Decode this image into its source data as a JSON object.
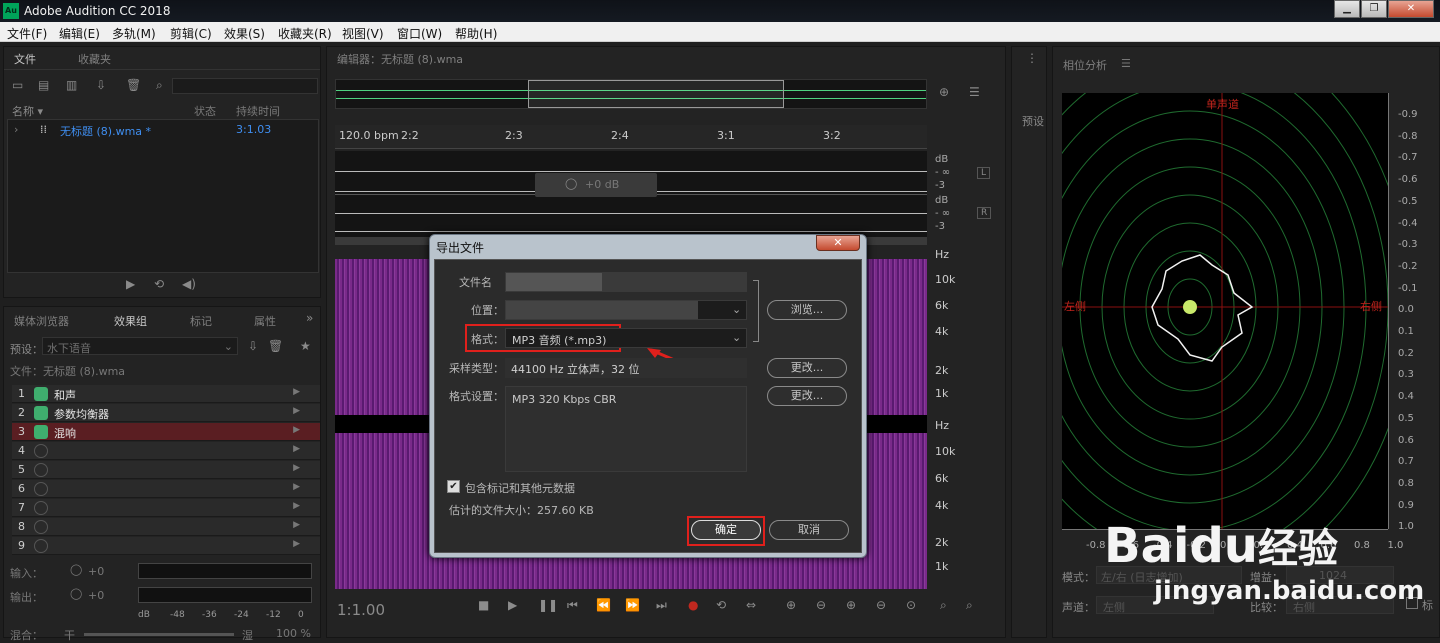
{
  "app": {
    "title": "Adobe Audition CC 2018",
    "logo": "Au",
    "win_buttons": [
      "▁",
      "❐",
      "✕"
    ]
  },
  "menu": [
    "文件(F)",
    "编辑(E)",
    "多轨(M)",
    "剪辑(C)",
    "效果(S)",
    "收藏夹(R)",
    "视图(V)",
    "窗口(W)",
    "帮助(H)"
  ],
  "files_panel": {
    "tabs": [
      "文件",
      "收藏夹"
    ],
    "columns": {
      "name": "名称 ▾",
      "status": "状态",
      "duration": "持续时间"
    },
    "file": {
      "name": "无标题 (8).wma *",
      "duration": "3:1.03"
    }
  },
  "effects_panel": {
    "tabs": [
      "媒体浏览器",
      "效果组",
      "标记",
      "属性"
    ],
    "preset_label": "预设：",
    "preset_value": "水下语音",
    "file_label": "文件：无标题 (8).wma",
    "rows": [
      {
        "n": "1",
        "label": "和声",
        "on": true
      },
      {
        "n": "2",
        "label": "参数均衡器",
        "on": true
      },
      {
        "n": "3",
        "label": "混响",
        "on": true,
        "selected": true
      },
      {
        "n": "4",
        "label": ""
      },
      {
        "n": "5",
        "label": ""
      },
      {
        "n": "6",
        "label": ""
      },
      {
        "n": "7",
        "label": ""
      },
      {
        "n": "8",
        "label": ""
      },
      {
        "n": "9",
        "label": ""
      }
    ],
    "input_label": "输入：",
    "output_label": "输出：",
    "io_value": "+0",
    "meter_scale": [
      "dB",
      "-48",
      "-36",
      "-24",
      "-12",
      "0"
    ],
    "mix_label": "混合：",
    "mix_left": "干",
    "mix_right": "湿",
    "mix_value": "100 %"
  },
  "editor": {
    "tab": "编辑器：无标题 (8).wma",
    "bpm": "120.0 bpm",
    "ruler": [
      "2:2",
      "2:3",
      "2:4",
      "3:1",
      "3:2"
    ],
    "hud_value": "+0 dB",
    "db_labels": [
      "dB",
      "- ∞",
      "-3"
    ],
    "ch": [
      "L",
      "R"
    ],
    "hz_labels": [
      "Hz",
      "10k",
      "6k",
      "4k",
      "2k",
      "1k"
    ],
    "time": "1:1.00"
  },
  "dialog": {
    "title": "导出文件",
    "close": "✕",
    "filename_label": "文件名",
    "location_label": "位置：",
    "browse": "浏览...",
    "format_label": "格式：",
    "format_value": "MP3 音频 (*.mp3)",
    "sample_label": "采样类型：",
    "sample_value": "44100 Hz 立体声，32 位",
    "change1": "更改...",
    "format_settings_label": "格式设置：",
    "format_settings_value": "MP3 320 Kbps CBR",
    "change2": "更改...",
    "checkbox_label": "包含标记和其他元数据",
    "size_label": "估计的文件大小：257.60 KB",
    "ok": "确定",
    "cancel": "取消"
  },
  "preset_side": {
    "label": "预设"
  },
  "phase_panel": {
    "title": "相位分析",
    "top": "单声道",
    "left": "左侧",
    "right": "右侧",
    "y_ticks": [
      "-0.9",
      "-0.8",
      "-0.7",
      "-0.6",
      "-0.5",
      "-0.4",
      "-0.3",
      "-0.2",
      "-0.1",
      "0.0",
      "0.1",
      "0.2",
      "0.3",
      "0.4",
      "0.5",
      "0.6",
      "0.7",
      "0.8",
      "0.9",
      "1.0"
    ],
    "x_ticks": [
      "-0.8",
      "-0.6",
      "-0.4",
      "-0.2",
      "0.0",
      "0.2",
      "0.4",
      "0.6",
      "0.8",
      "1.0"
    ],
    "mode_label": "模式：",
    "mode_value": "左/右 (日志增加)",
    "gain_label": "增益：",
    "gain_value": "1024",
    "channel_label": "声道：",
    "channel_value": "左侧",
    "compare_label": "比较：",
    "compare_value": "右侧",
    "extra": "标"
  },
  "watermark": {
    "brand": "Bai",
    "paw": "du",
    "cn": "经验",
    "url": "jingyan.baidu.com"
  }
}
